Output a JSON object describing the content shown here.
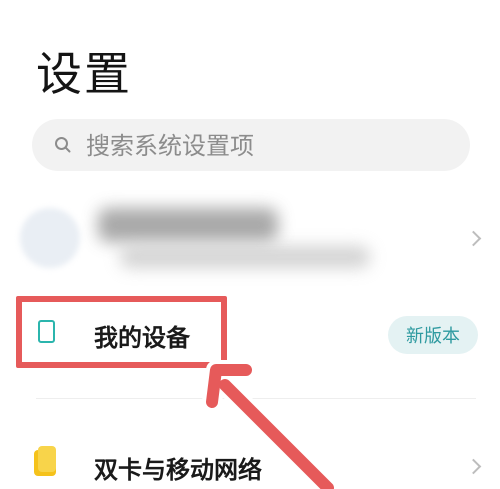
{
  "header": {
    "title": "设置"
  },
  "search": {
    "placeholder": "搜索系统设置项"
  },
  "account": {},
  "items": [
    {
      "label": "我的设备",
      "badge": "新版本",
      "icon": "phone-outline-icon"
    },
    {
      "label": "双卡与移动网络",
      "icon": "sim-card-icon"
    }
  ],
  "colors": {
    "highlight": "#e65a5a",
    "accent": "#2e9aa0",
    "badge_bg": "#e4f2f3",
    "sim_icon": "#f5c21b"
  }
}
